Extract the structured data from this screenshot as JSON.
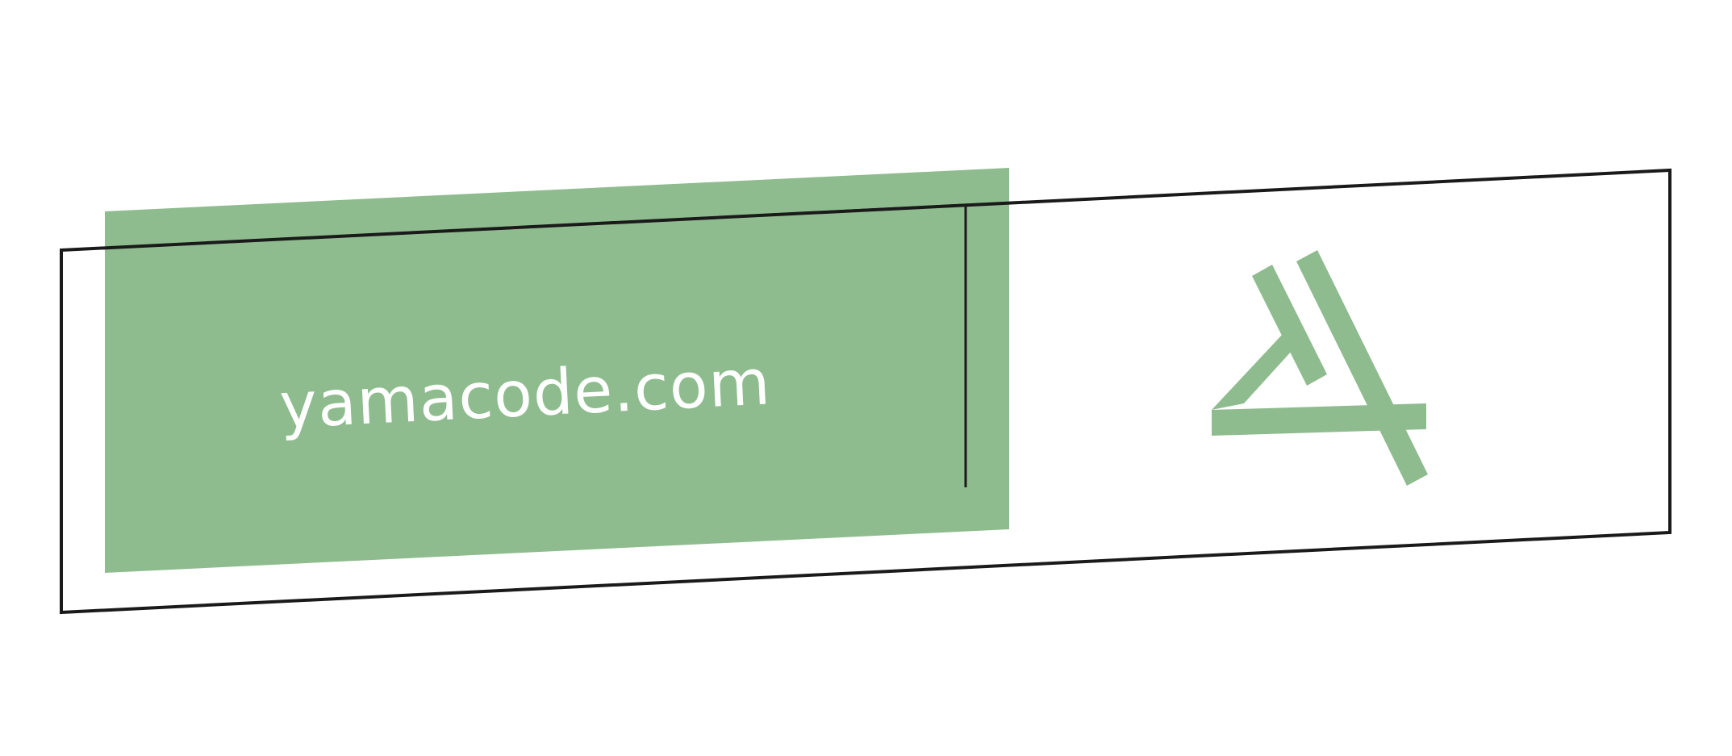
{
  "logo": {
    "brand_text": "yamacode.com",
    "colors": {
      "accent_green": "#8fbc8f",
      "outline": "#1a1a1a",
      "text": "#ffffff",
      "background": "#ffffff"
    },
    "icon": "yamacode-monogram-icon"
  }
}
